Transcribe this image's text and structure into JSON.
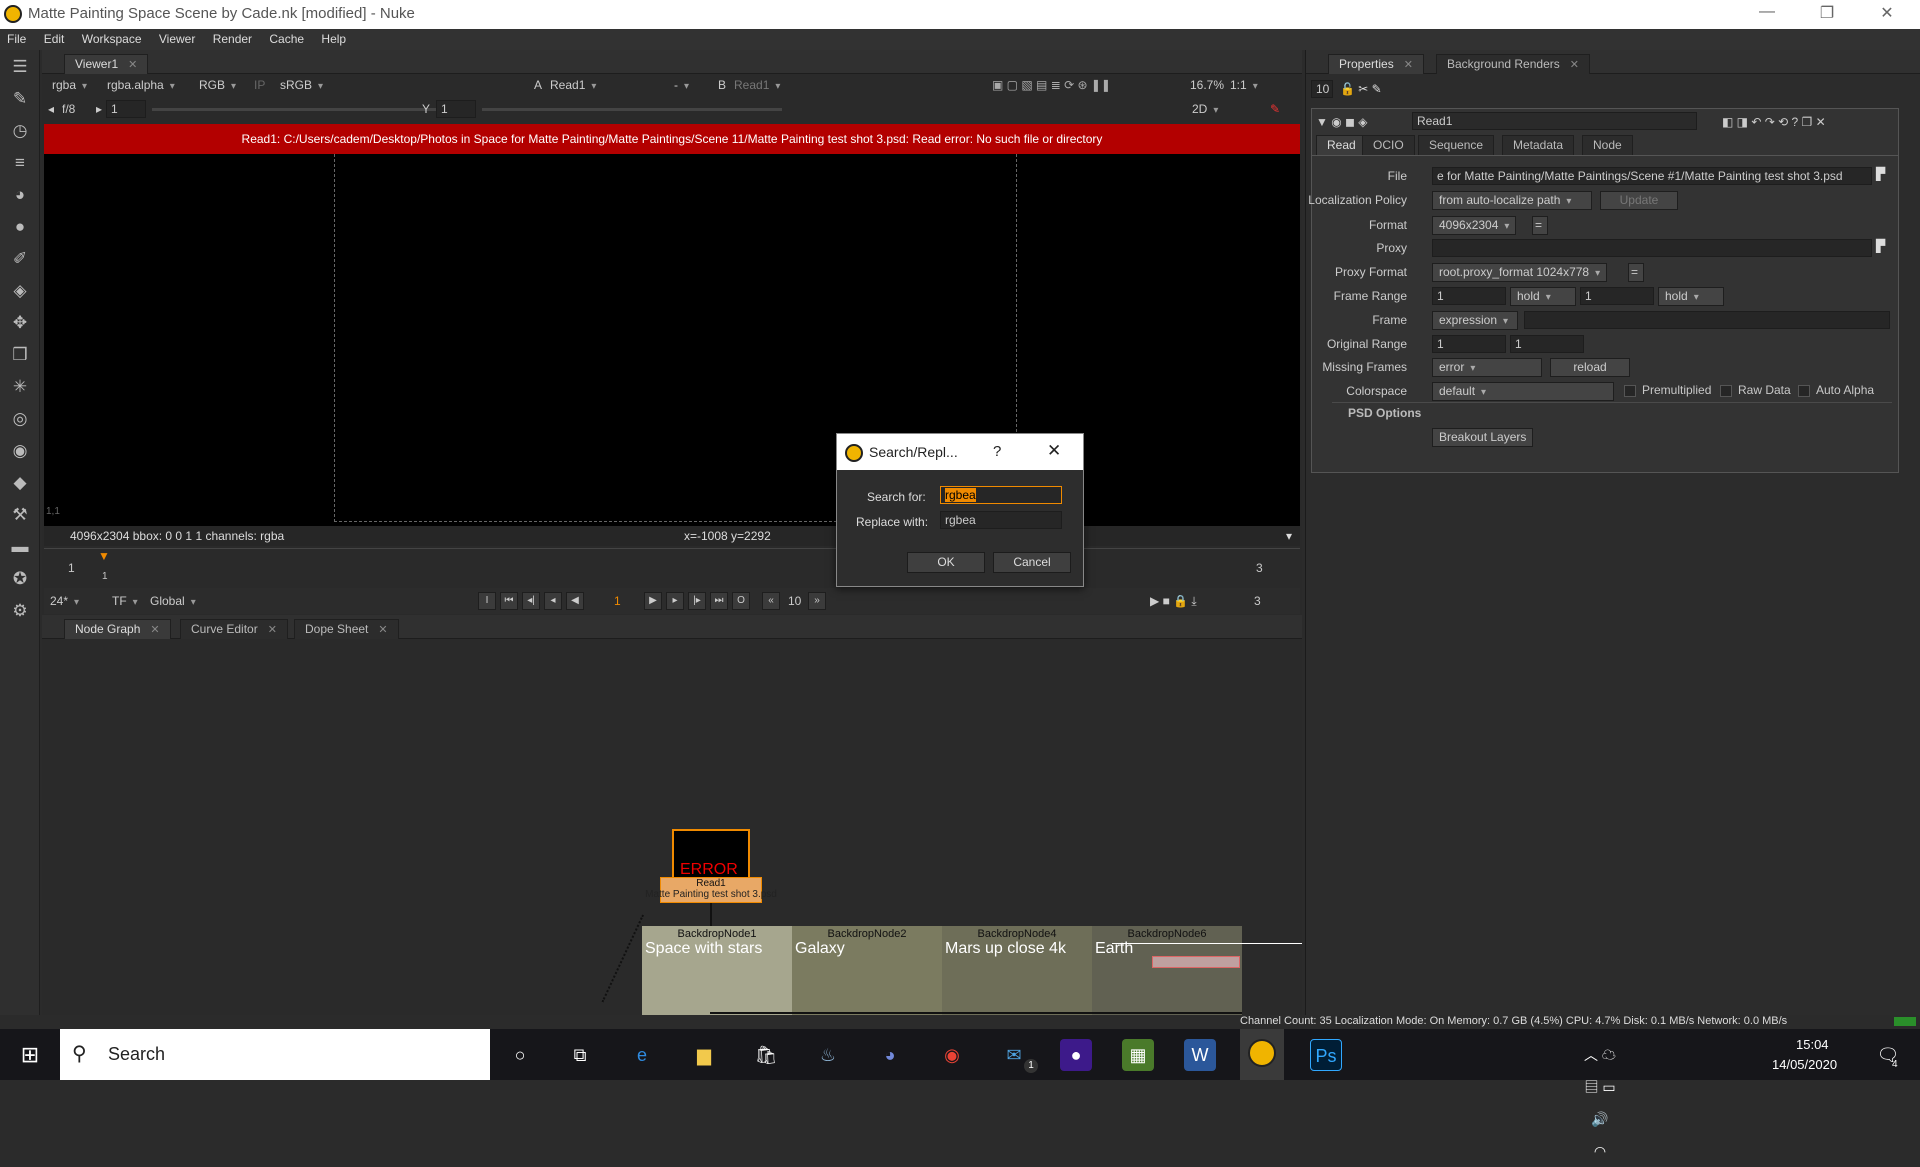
{
  "window": {
    "title": "Matte Painting Space Scene by Cade.nk [modified] - Nuke",
    "controls": [
      "—",
      "❐",
      "✕"
    ]
  },
  "menu": [
    "File",
    "Edit",
    "Workspace",
    "Viewer",
    "Render",
    "Cache",
    "Help"
  ],
  "viewer": {
    "tab": "Viewer1",
    "channels": "rgba",
    "alpha": "rgba.alpha",
    "colorspace_mode": "RGB",
    "ip": "IP",
    "lut": "sRGB",
    "input_a_label": "A",
    "input_a": "Read1",
    "input_mid": "-",
    "input_b_label": "B",
    "input_b": "Read1",
    "gain": "f/8",
    "gain_value": "1",
    "gamma_label": "Y",
    "gamma_value": "1",
    "zoom": "16.7%",
    "proxy_ratio": "1:1",
    "view_mode": "2D",
    "error_message": "Read1: C:/Users/cadem/Desktop/Photos in Space for Matte Painting/Matte Paintings/Scene 11/Matte Painting test shot 3.psd: Read error: No such file or directory",
    "corner_label": "1,1",
    "info_left": "4096x2304   bbox: 0 0 1 1  channels: rgba",
    "info_coords": "x=-1008 y=2292",
    "timeline_start": "1",
    "timeline_end": "3",
    "timeline_marker": "1",
    "fps": "24*",
    "tf": "TF",
    "global": "Global",
    "current_frame": "1",
    "step": "10",
    "end_frame": "3"
  },
  "bottom_tabs": [
    "Node Graph",
    "Curve Editor",
    "Dope Sheet"
  ],
  "nodes": {
    "read_node_error": "ERROR",
    "read_node_name": "Read1",
    "read_node_file": "Matte Painting test shot 3.psd",
    "backdrops": [
      {
        "name": "BackdropNode1",
        "label": "Space with stars"
      },
      {
        "name": "BackdropNode2",
        "label": "Galaxy"
      },
      {
        "name": "BackdropNode4",
        "label": "Mars up close 4k"
      },
      {
        "name": "BackdropNode6",
        "label": "Earth"
      }
    ]
  },
  "properties": {
    "tabs": [
      "Properties",
      "Background Renders"
    ],
    "max_panels": "10",
    "node_name": "Read1",
    "subtabs": [
      "Read",
      "OCIO",
      "Sequence",
      "Metadata",
      "Node"
    ],
    "file_label": "File",
    "file_value": "e for Matte Painting/Matte Paintings/Scene #1/Matte Painting test shot 3.psd",
    "localization_label": "Localization Policy",
    "localization_value": "from auto-localize path",
    "update_label": "Update",
    "format_label": "Format",
    "format_value": "4096x2304",
    "proxy_label": "Proxy",
    "proxy_format_label": "Proxy Format",
    "proxy_format_value": "root.proxy_format 1024x778",
    "frame_range_label": "Frame Range",
    "frame_range_start": "1",
    "frame_range_before": "hold",
    "frame_range_end": "1",
    "frame_range_after": "hold",
    "frame_label": "Frame",
    "frame_value": "expression",
    "original_range_label": "Original Range",
    "original_range_start": "1",
    "original_range_end": "1",
    "missing_frames_label": "Missing Frames",
    "missing_frames_value": "error",
    "reload_label": "reload",
    "colorspace_label": "Colorspace",
    "colorspace_value": "default",
    "premultiplied_label": "Premultiplied",
    "raw_data_label": "Raw Data",
    "auto_alpha_label": "Auto Alpha",
    "psd_options_label": "PSD Options",
    "breakout_layers_label": "Breakout Layers"
  },
  "status_bar": "Channel Count: 35  Localization Mode: On  Memory: 0.7 GB (4.5%)  CPU: 4.7%  Disk: 0.1 MB/s  Network: 0.0 MB/s",
  "dialog": {
    "title": "Search/Repl...",
    "help": "?",
    "search_label": "Search for:",
    "search_value": "rgbea",
    "replace_label": "Replace with:",
    "replace_value": "rgbea",
    "ok_label": "OK",
    "cancel_label": "Cancel"
  },
  "taskbar": {
    "search_placeholder": "Search",
    "time": "15:04",
    "date": "14/05/2020",
    "mail_badge": "1",
    "notif_badge": "4"
  },
  "colors": {
    "error_red": "#b30000",
    "nuke_orange": "#f0b400",
    "selection_orange": "#f08a00"
  }
}
